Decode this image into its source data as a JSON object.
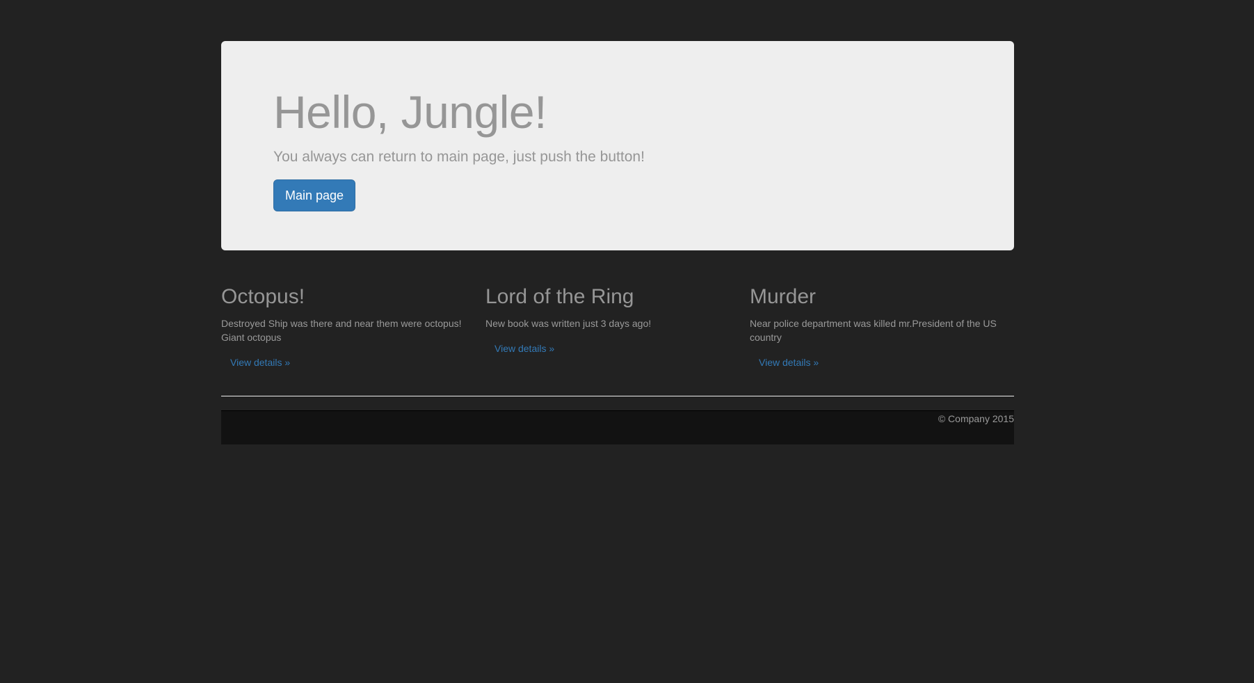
{
  "jumbotron": {
    "heading": "Hello, Jungle!",
    "lead": "You always can return to main page, just push the button!",
    "button_label": "Main page"
  },
  "columns": [
    {
      "title": "Octopus!",
      "text": "Destroyed Ship was there and near them were octopus! Giant octopus",
      "link": "View details »"
    },
    {
      "title": "Lord of the Ring",
      "text": "New book was written just 3 days ago!",
      "link": "View details »"
    },
    {
      "title": "Murder",
      "text": "Near police department was killed mr.President of the US country",
      "link": "View details »"
    }
  ],
  "footer": {
    "copyright": "© Company 2015"
  },
  "colors": {
    "page_background": "#222222",
    "jumbotron_background": "#eeeeee",
    "primary_button": "#337ab7",
    "link": "#337ab7",
    "footer_background": "#121212"
  }
}
